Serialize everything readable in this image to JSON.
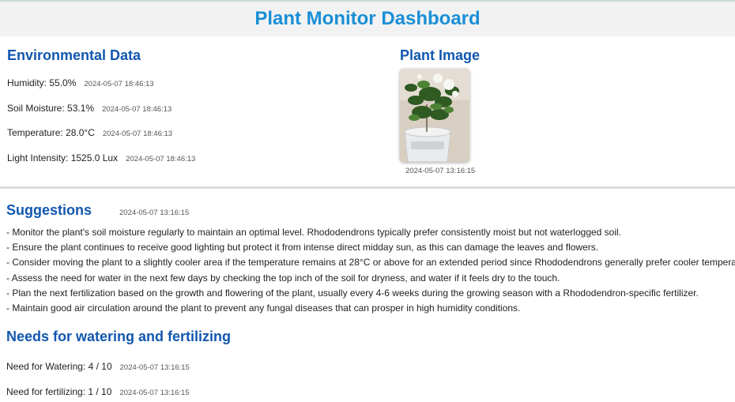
{
  "header": {
    "title": "Plant Monitor Dashboard"
  },
  "environment": {
    "title": "Environmental Data",
    "readings": [
      {
        "text": "Humidity: 55.0%",
        "timestamp": "2024-05-07 18:46:13"
      },
      {
        "text": "Soil Moisture: 53.1%",
        "timestamp": "2024-05-07 18:46:13"
      },
      {
        "text": "Temperature: 28.0°C",
        "timestamp": "2024-05-07 18:46:13"
      },
      {
        "text": "Light Intensity: 1525.0 Lux",
        "timestamp": "2024-05-07 18:46:13"
      }
    ]
  },
  "plant_image": {
    "title": "Plant Image",
    "timestamp": "2024-05-07 13:16:15"
  },
  "suggestions": {
    "title": "Suggestions",
    "timestamp": "2024-05-07 13:16:15",
    "items": [
      "- Monitor the plant's soil moisture regularly to maintain an optimal level. Rhododendrons typically prefer consistently moist but not waterlogged soil.",
      "- Ensure the plant continues to receive good lighting but protect it from intense direct midday sun, as this can damage the leaves and flowers.",
      "- Consider moving the plant to a slightly cooler area if the temperature remains at 28°C or above for an extended period since Rhododendrons generally prefer cooler temperatures.",
      "- Assess the need for water in the next few days by checking the top inch of the soil for dryness, and water if it feels dry to the touch.",
      "- Plan the next fertilization based on the growth and flowering of the plant, usually every 4-6 weeks during the growing season with a Rhododendron-specific fertilizer.",
      "- Maintain good air circulation around the plant to prevent any fungal diseases that can prosper in high humidity conditions."
    ]
  },
  "needs": {
    "title": "Needs for watering and fertilizing",
    "items": [
      {
        "text": "Need for Watering: 4 / 10",
        "timestamp": "2024-05-07 13:16:15"
      },
      {
        "text": "Need for fertilizing: 1 / 10",
        "timestamp": "2024-05-07 13:16:15"
      }
    ]
  }
}
